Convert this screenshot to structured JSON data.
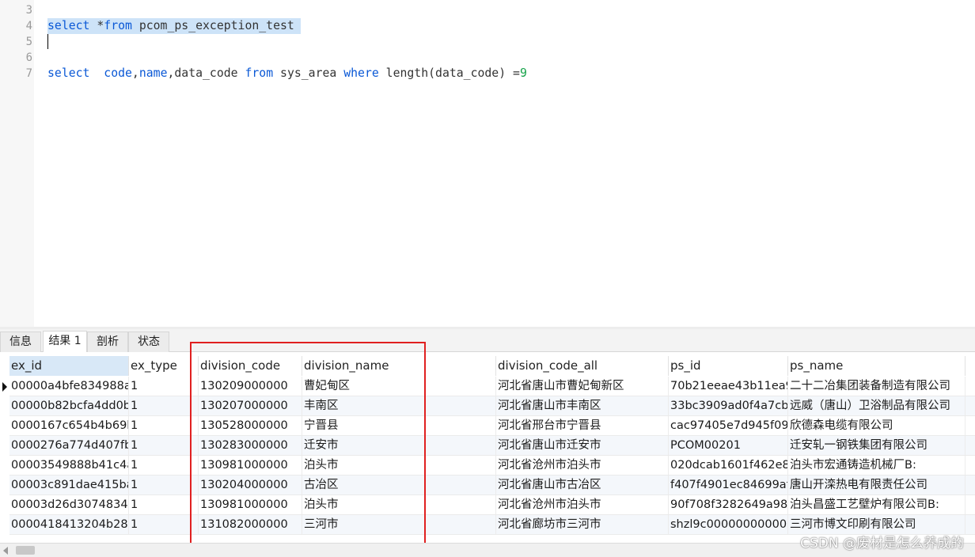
{
  "editor": {
    "line_numbers": [
      "3",
      "4",
      "5",
      "6",
      "7"
    ],
    "lines": [
      [],
      [
        {
          "t": "select",
          "k": "kw"
        },
        {
          "t": " *",
          "k": "op"
        },
        {
          "t": "from",
          "k": "kw"
        },
        {
          "t": " pcom_ps_exception_test",
          "k": "id"
        }
      ],
      [],
      [],
      [
        {
          "t": "select",
          "k": "kw"
        },
        {
          "t": "  ",
          "k": "op"
        },
        {
          "t": "code",
          "k": "col"
        },
        {
          "t": ",",
          "k": "op"
        },
        {
          "t": "name",
          "k": "col"
        },
        {
          "t": ",data_code ",
          "k": "id"
        },
        {
          "t": "from",
          "k": "kw"
        },
        {
          "t": " sys_area ",
          "k": "id"
        },
        {
          "t": "where",
          "k": "kw"
        },
        {
          "t": " length(data_code) =",
          "k": "fn"
        },
        {
          "t": "9",
          "k": "num"
        }
      ]
    ]
  },
  "tabs": [
    {
      "label": "信息",
      "active": false
    },
    {
      "label": "结果 1",
      "active": true
    },
    {
      "label": "剖析",
      "active": false
    },
    {
      "label": "状态",
      "active": false
    }
  ],
  "grid": {
    "columns": [
      "ex_id",
      "ex_type",
      "division_code",
      "division_name",
      "division_code_all",
      "ps_id",
      "ps_name"
    ],
    "rows": [
      [
        "00000a4bfe834988a",
        "1",
        "130209000000",
        "曹妃甸区",
        "河北省唐山市曹妃甸新区",
        "70b21eeae43b11ea9",
        "二十二冶集团装备制造有限公司"
      ],
      [
        "00000b82bcfa4dd0b",
        "1",
        "130207000000",
        "丰南区",
        "河北省唐山市丰南区",
        "33bc3909ad0f4a7cb",
        "远威（唐山）卫浴制品有限公司"
      ],
      [
        "0000167c654b4b69l",
        "1",
        "130528000000",
        "宁晋县",
        "河北省邢台市宁晋县",
        "cac97405e7d945f09",
        "欣德森电缆有限公司"
      ],
      [
        "0000276a774d407fb",
        "1",
        "130283000000",
        "迁安市",
        "河北省唐山市迁安市",
        "PCOM00201",
        "迁安轧一钢铁集团有限公司"
      ],
      [
        "00003549888b41c4a",
        "1",
        "130981000000",
        "泊头市",
        "河北省沧州市泊头市",
        "020dcab1601f462e8",
        "泊头市宏通铸造机械厂B:"
      ],
      [
        "00003c891dae415ba",
        "1",
        "130204000000",
        "古冶区",
        "河北省唐山市古冶区",
        "f407f4901ec84699af",
        "唐山开滦热电有限责任公司"
      ],
      [
        "00003d26d3074834",
        "1",
        "130981000000",
        "泊头市",
        "河北省沧州市泊头市",
        "90f708f3282649a98",
        "泊头昌盛工艺壁炉有限公司B:"
      ],
      [
        "0000418413204b28l",
        "1",
        "131082000000",
        "三河市",
        "河北省廊坊市三河市",
        "shzl9c00000000000",
        "三河市博文印刷有限公司"
      ]
    ]
  },
  "watermark": "CSDN @废材是怎么养成的",
  "colors": {
    "keyword": "#0a58d6",
    "number": "#16a34a",
    "highlight_box": "#e02020",
    "selection": "#cde3f8"
  }
}
